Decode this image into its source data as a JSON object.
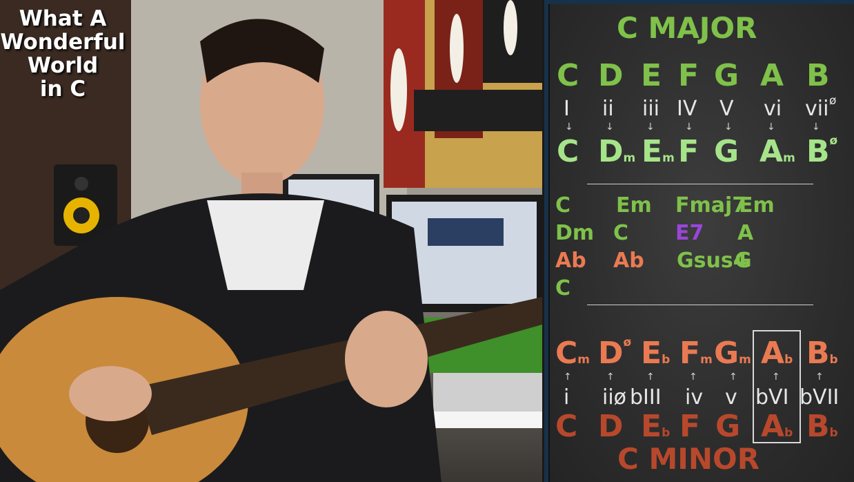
{
  "video": {
    "title_overlay": "What A\nWonderful\nWorld\nin C"
  },
  "major": {
    "title": "C MAJOR",
    "notes": [
      "C",
      "D",
      "E",
      "F",
      "G",
      "A",
      "B"
    ],
    "numerals": [
      "I",
      "ii",
      "iii",
      "IV",
      "V",
      "vi",
      "vii"
    ],
    "numeral_suffix": "ø",
    "arrow": "↓",
    "chords": [
      {
        "root": "C",
        "sub": ""
      },
      {
        "root": "D",
        "sub": "m"
      },
      {
        "root": "E",
        "sub": "m"
      },
      {
        "root": "F",
        "sub": ""
      },
      {
        "root": "G",
        "sub": ""
      },
      {
        "root": "A",
        "sub": "m"
      },
      {
        "root": "B",
        "sub": "ø"
      }
    ]
  },
  "progression": {
    "rows": [
      [
        "C",
        "Em",
        "Fmaj7",
        "Em"
      ],
      [
        "Dm",
        "C",
        "E7",
        "A"
      ],
      [
        "Ab",
        "Ab",
        "Gsus4",
        "G"
      ],
      [
        "C"
      ]
    ]
  },
  "minor": {
    "title": "C MINOR",
    "chords": [
      {
        "root": "C",
        "sub": "m"
      },
      {
        "root": "D",
        "sub": "ø"
      },
      {
        "root": "E",
        "sub": "b"
      },
      {
        "root": "F",
        "sub": "m"
      },
      {
        "root": "G",
        "sub": "m"
      },
      {
        "root": "A",
        "sub": "b"
      },
      {
        "root": "B",
        "sub": "b"
      }
    ],
    "arrow": "↑",
    "numerals": [
      "i",
      "iiø",
      "bIII",
      "iv",
      "v",
      "bVI",
      "bVII"
    ],
    "notes": [
      {
        "root": "C",
        "sub": ""
      },
      {
        "root": "D",
        "sub": ""
      },
      {
        "root": "E",
        "sub": "b"
      },
      {
        "root": "F",
        "sub": ""
      },
      {
        "root": "G",
        "sub": ""
      },
      {
        "root": "A",
        "sub": "b"
      },
      {
        "root": "B",
        "sub": "b"
      }
    ],
    "highlighted_column": "bVI"
  },
  "colors": {
    "major_green": "#7fc14a",
    "chord_green": "#a6e48a",
    "minor_orange": "#ea7a52",
    "minor_dark": "#b8482c",
    "purple": "#9a46d8",
    "board_bg": "#2d2d2d"
  }
}
